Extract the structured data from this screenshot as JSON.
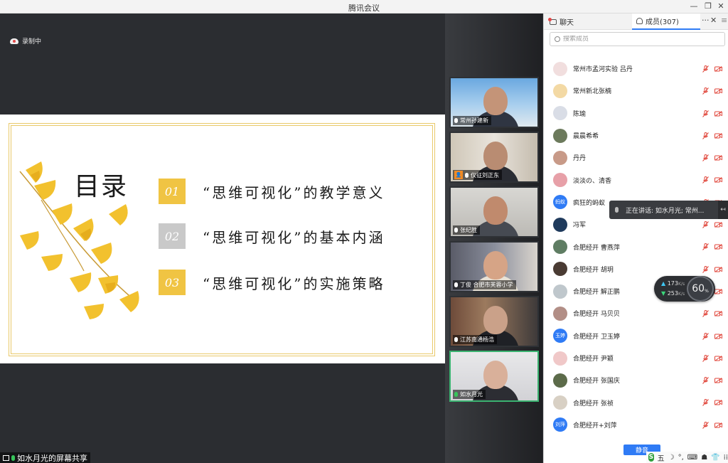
{
  "window": {
    "title": "腾讯会议",
    "controls": [
      "—",
      "❐",
      "✕"
    ]
  },
  "recording": {
    "label": "录制中"
  },
  "slide": {
    "heading": "目录",
    "items": [
      {
        "num": "01",
        "text": "“思维可视化”的教学意义",
        "color": "#f0c443"
      },
      {
        "num": "02",
        "text": "“思维可视化”的基本内涵",
        "color": "#c9c9c9"
      },
      {
        "num": "03",
        "text": "“思维可视化”的实施策略",
        "color": "#f0c443"
      }
    ]
  },
  "screen_share": {
    "label": "如水月光的屏幕共享"
  },
  "video_tiles": [
    {
      "name": "常州孙建新",
      "active": false
    },
    {
      "name": "仪征刘正东",
      "active": false
    },
    {
      "name": "张纪胜",
      "active": false
    },
    {
      "name": "丁俊  合肥市芙蓉小学",
      "active": false
    },
    {
      "name": "江苏南通杨浩",
      "active": false
    },
    {
      "name": "如水月光",
      "active": true
    }
  ],
  "panel": {
    "tab_chat": "聊天",
    "tab_members": "成员(307)",
    "more_icon": "···",
    "close_icon": "✕",
    "menu_icon": "≡",
    "search_placeholder": "搜索成员",
    "mute_all": "静音",
    "members": [
      {
        "name": "常州市孟河实验 吕丹",
        "avatar": "",
        "color": "#f1dede"
      },
      {
        "name": "常州新北张楠",
        "avatar": "",
        "color": "#f3d9a4"
      },
      {
        "name": "陈瑜",
        "avatar": "",
        "color": "#d9dde6"
      },
      {
        "name": "晨晨希希",
        "avatar": "",
        "color": "#6c7a5c"
      },
      {
        "name": "丹丹",
        "avatar": "",
        "color": "#c89a88"
      },
      {
        "name": "淡淡の、清香",
        "avatar": "",
        "color": "#e7a0a8"
      },
      {
        "name": "疯狂的蚂蚁",
        "avatar": "蚂蚁",
        "color": "#2f7bf5"
      },
      {
        "name": "冯军",
        "avatar": "",
        "color": "#1f3a5c"
      },
      {
        "name": "合肥经开  曹燕萍",
        "avatar": "",
        "color": "#5f7d63"
      },
      {
        "name": "合肥经开  胡玥",
        "avatar": "",
        "color": "#4a3b33"
      },
      {
        "name": "合肥经开  解正鹏",
        "avatar": "",
        "color": "#bfc7cc"
      },
      {
        "name": "合肥经开  马贝贝",
        "avatar": "",
        "color": "#b28e86"
      },
      {
        "name": "合肥经开  卫玉婷",
        "avatar": "玉婷",
        "color": "#2f7bf5"
      },
      {
        "name": "合肥经开  尹颖",
        "avatar": "",
        "color": "#f0c8c8"
      },
      {
        "name": "合肥经开  张国庆",
        "avatar": "",
        "color": "#5c6b4a"
      },
      {
        "name": "合肥经开  张祯",
        "avatar": "",
        "color": "#d8d0c4"
      },
      {
        "name": "合肥经开+刘萍",
        "avatar": "刘萍",
        "color": "#2f7bf5"
      }
    ]
  },
  "speaking": {
    "label": "正在讲话: 如水月光; 常州...",
    "arrow": "↤"
  },
  "network": {
    "up_arrow": "▲",
    "down_arrow": "▼",
    "up": "173",
    "down": "253",
    "unit": "K/s",
    "value": "60",
    "value_unit": "%"
  },
  "ime": {
    "logo": "S",
    "mode": "五",
    "icons": [
      "☽",
      "°,",
      "⌨",
      "☗",
      "👕",
      "⁞⁞"
    ]
  },
  "colors": {
    "accent": "#2f7bf5",
    "active_speaker": "#3bb371",
    "muted": "#e0453a"
  }
}
